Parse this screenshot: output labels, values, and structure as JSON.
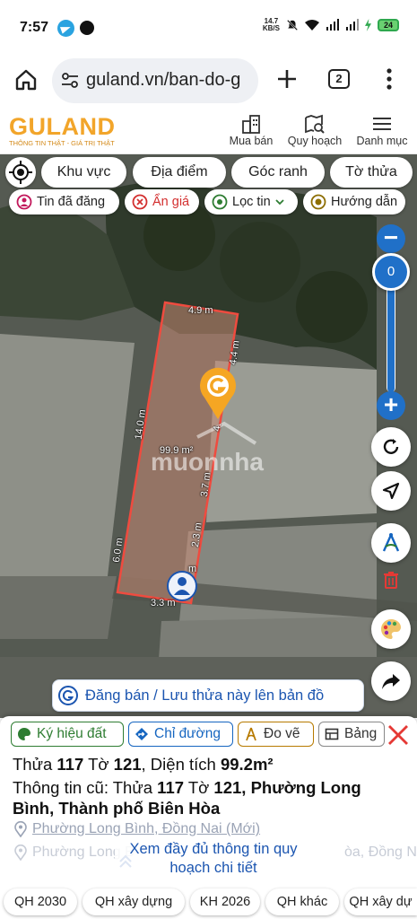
{
  "status_bar": {
    "time": "7:57",
    "speed_top": "14.7",
    "speed_unit": "KB/S",
    "battery": "24"
  },
  "browser": {
    "url": "guland.vn/ban-do-g",
    "tab_count": "2"
  },
  "site_header": {
    "logo_text": "GULAND",
    "logo_tagline": "THÔNG TIN THẬT - GIÁ TRỊ THẬT",
    "nav": [
      {
        "label": "Mua bán",
        "icon": "buildings-icon"
      },
      {
        "label": "Quy hoạch",
        "icon": "map-search-icon"
      },
      {
        "label": "Danh mục",
        "icon": "hamburger-icon"
      }
    ]
  },
  "map": {
    "search_tabs": [
      "Khu vực",
      "Địa điểm",
      "Góc ranh",
      "Tờ thửa"
    ],
    "filters": [
      {
        "label": "Tin đã đăng",
        "color": "#c2185b"
      },
      {
        "label": "Ẩn giá",
        "color": "#d32f2f"
      },
      {
        "label": "Lọc tin",
        "color": "#2e7d32"
      },
      {
        "label": "Hướng dẫn",
        "color": "#8d6e00"
      }
    ],
    "zoom_value": "0",
    "parcel": {
      "area_label": "99.9 m²",
      "edge_labels": [
        "4.9 m",
        "4.4 m",
        "4.",
        "3.7 m",
        "2.3 m",
        "m",
        "3.3 m",
        "6.0 m",
        "14.0 m"
      ]
    },
    "watermark": "muonnha",
    "post_cta": "Đăng bán / Lưu thửa này lên bản đồ"
  },
  "panel": {
    "chips": [
      {
        "label": "Ký hiệu đất",
        "color": "#2e7d32"
      },
      {
        "label": "Chỉ đường",
        "color": "#1565c0"
      },
      {
        "label": "Đo vẽ",
        "color": "#b77a00"
      },
      {
        "label": "Bảng",
        "color": "#555555"
      }
    ],
    "line1_prefix": "Thửa ",
    "line1_parcel": "117",
    "line1_mid": " Tờ ",
    "line1_sheet": "121",
    "line1_area_label": ", Diện tích ",
    "line1_area": "99.2m²",
    "line2_prefix": "Thông tin cũ: Thửa ",
    "line2_parcel": "117",
    "line2_mid": " Tờ ",
    "line2_sheet": "121",
    "line2_rest": ", Phường Long Bình, Thành phố Biên Hòa",
    "address_new": "Phường Long Bình, Đồng Nai (Mới)",
    "address_old_left": "Phường Long B",
    "address_old_right": "òa, Đồng Nai",
    "see_full": "Xem đầy đủ thông tin quy hoạch chi tiết"
  },
  "bottom_chips": [
    "QH 2030",
    "QH xây dựng",
    "KH 2026",
    "QH khác",
    "QH xây dự"
  ]
}
